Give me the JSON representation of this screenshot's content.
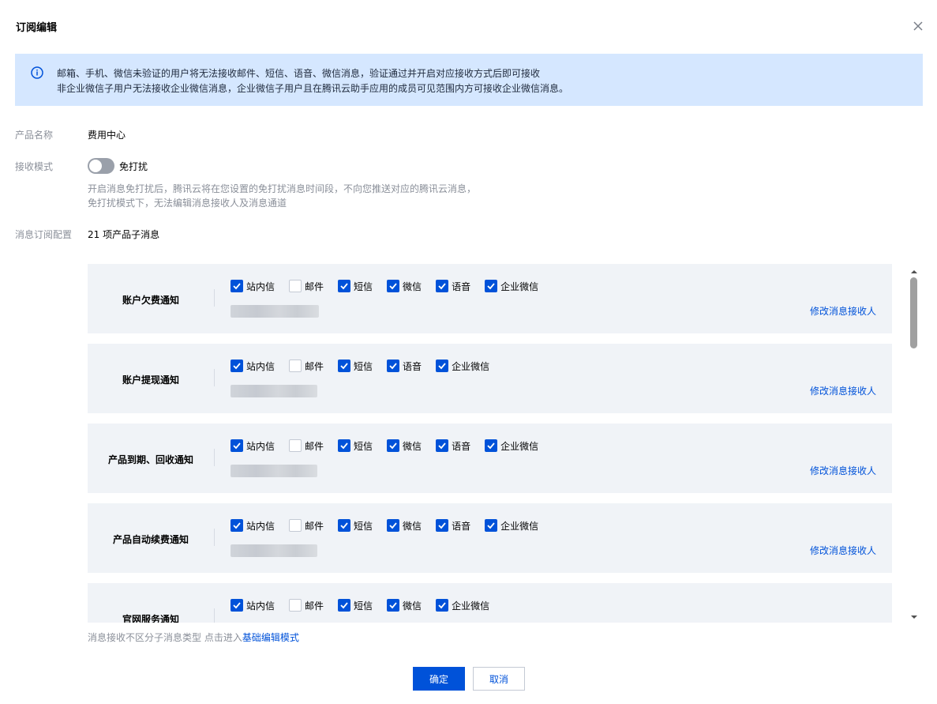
{
  "dialog": {
    "title": "订阅编辑",
    "close_icon": "close-icon"
  },
  "notice": {
    "icon": "info-circle-icon",
    "line1": "邮箱、手机、微信未验证的用户将无法接收邮件、短信、语音、微信消息，验证通过并开启对应接收方式后即可接收",
    "line2": "非企业微信子用户无法接收企业微信消息，企业微信子用户且在腾讯云助手应用的成员可见范围内方可接收企业微信消息。"
  },
  "fields": {
    "product_label": "产品名称",
    "product_value": "费用中心",
    "mode_label": "接收模式",
    "mode_toggle_label": "免打扰",
    "mode_toggle_on": false,
    "mode_hint1": "开启消息免打扰后，腾讯云将在您设置的免打扰消息时间段，不向您推送对应的腾讯云消息，",
    "mode_hint2": "免打扰模式下，无法编辑消息接收人及消息通道",
    "config_label": "消息订阅配置",
    "config_value": "21 项产品子消息"
  },
  "cards": [
    {
      "name": "账户欠费通知",
      "options": [
        {
          "label": "站内信",
          "checked": true
        },
        {
          "label": "邮件",
          "checked": false
        },
        {
          "label": "短信",
          "checked": true
        },
        {
          "label": "微信",
          "checked": true
        },
        {
          "label": "语音",
          "checked": true
        },
        {
          "label": "企业微信",
          "checked": true
        }
      ],
      "link": "修改消息接收人"
    },
    {
      "name": "账户提现通知",
      "options": [
        {
          "label": "站内信",
          "checked": true
        },
        {
          "label": "邮件",
          "checked": false
        },
        {
          "label": "短信",
          "checked": true
        },
        {
          "label": "语音",
          "checked": true
        },
        {
          "label": "企业微信",
          "checked": true
        }
      ],
      "link": "修改消息接收人"
    },
    {
      "name": "产品到期、回收通知",
      "options": [
        {
          "label": "站内信",
          "checked": true
        },
        {
          "label": "邮件",
          "checked": false
        },
        {
          "label": "短信",
          "checked": true
        },
        {
          "label": "微信",
          "checked": true
        },
        {
          "label": "语音",
          "checked": true
        },
        {
          "label": "企业微信",
          "checked": true
        }
      ],
      "link": "修改消息接收人"
    },
    {
      "name": "产品自动续费通知",
      "options": [
        {
          "label": "站内信",
          "checked": true
        },
        {
          "label": "邮件",
          "checked": false
        },
        {
          "label": "短信",
          "checked": true
        },
        {
          "label": "微信",
          "checked": true
        },
        {
          "label": "语音",
          "checked": true
        },
        {
          "label": "企业微信",
          "checked": true
        }
      ],
      "link": "修改消息接收人"
    },
    {
      "name": "官网服务通知",
      "options": [
        {
          "label": "站内信",
          "checked": true
        },
        {
          "label": "邮件",
          "checked": false
        },
        {
          "label": "短信",
          "checked": true
        },
        {
          "label": "微信",
          "checked": true
        },
        {
          "label": "企业微信",
          "checked": true
        }
      ],
      "link": ""
    }
  ],
  "footer": {
    "hint": "消息接收不区分子消息类型 点击进入",
    "hint_link": "基础编辑模式",
    "ok_label": "确定",
    "cancel_label": "取消"
  },
  "colors": {
    "accent": "#0052d9",
    "notice_bg": "#d5e7ff",
    "card_bg": "#f0f3f7",
    "muted_text": "#8a8f99"
  }
}
